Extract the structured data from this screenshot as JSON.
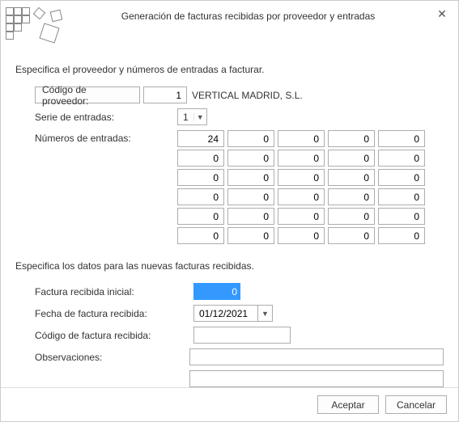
{
  "window": {
    "title": "Generación de facturas recibidas por proveedor y entradas"
  },
  "section1": {
    "intro": "Especifica el proveedor y números de entradas a facturar.",
    "supplier_code_btn": "Código de proveedor:",
    "supplier_code_value": "1",
    "supplier_name": "VERTICAL MADRID, S.L.",
    "series_label": "Serie de entradas:",
    "series_value": "1",
    "numbers_label": "Números de entradas:",
    "numbers": [
      [
        "24",
        "0",
        "0",
        "0",
        "0"
      ],
      [
        "0",
        "0",
        "0",
        "0",
        "0"
      ],
      [
        "0",
        "0",
        "0",
        "0",
        "0"
      ],
      [
        "0",
        "0",
        "0",
        "0",
        "0"
      ],
      [
        "0",
        "0",
        "0",
        "0",
        "0"
      ],
      [
        "0",
        "0",
        "0",
        "0",
        "0"
      ]
    ]
  },
  "section2": {
    "intro": "Especifica los datos para las nuevas facturas recibidas.",
    "initial_invoice_label": "Factura recibida inicial:",
    "initial_invoice_value": "0",
    "date_label": "Fecha de factura recibida:",
    "date_value": "01/12/2021",
    "code_label": "Código de factura recibida:",
    "code_value": "",
    "obs_label": "Observaciones:",
    "obs_value1": "",
    "obs_value2": ""
  },
  "footer": {
    "accept": "Aceptar",
    "cancel": "Cancelar"
  }
}
